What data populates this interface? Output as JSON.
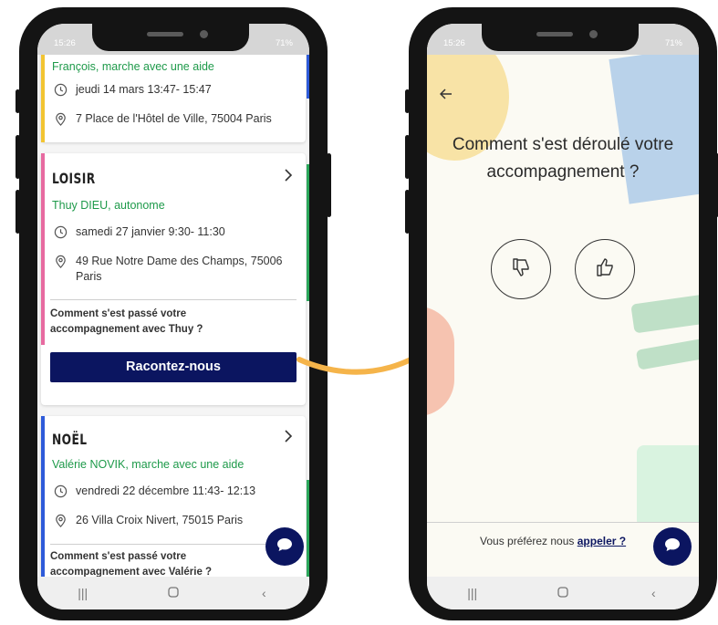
{
  "status": {
    "time": "15:26",
    "battery": "71%"
  },
  "left": {
    "card0": {
      "who": "François, marche avec une aide",
      "date": "jeudi 14 mars 13:47- 15:47",
      "address": "7 Place de l'Hôtel de Ville, 75004 Paris",
      "stripe_color": "#f2c432"
    },
    "card1": {
      "title": "LOISIR",
      "who": "Thuy DIEU, autonome",
      "date": "samedi 27 janvier 9:30- 11:30",
      "address_line1": "49 Rue Notre Dame des Champs, 75006",
      "address_line2": "Paris",
      "question_line1": "Comment s'est passé votre",
      "question_line2": "accompagnement avec Thuy ?",
      "cta": "Racontez-nous",
      "stripe_color": "#e76aa0"
    },
    "card2": {
      "title": "NOËL",
      "who": "Valérie NOVIK, marche avec une aide",
      "date": "vendredi 22 décembre 11:43- 12:13",
      "address": "26 Villa Croix Nivert, 75015 Paris",
      "question_line1": "Comment s'est passé votre",
      "question_line2": "accompagnement avec Valérie ?",
      "stripe_color": "#2e5bd9"
    }
  },
  "right": {
    "title_line1": "Comment s'est déroulé votre",
    "title_line2": "accompagnement ?",
    "footer_text": "Vous préférez nous",
    "footer_link": "appeler ?"
  },
  "colors": {
    "primary": "#0b1560",
    "green": "#1e9a4a",
    "arrow": "#f5b44a"
  },
  "icons": [
    "clock-icon",
    "location-pin-icon",
    "chevron-right-icon",
    "chat-bubble-icon",
    "thumbs-down-icon",
    "thumbs-up-icon",
    "back-arrow-icon"
  ]
}
